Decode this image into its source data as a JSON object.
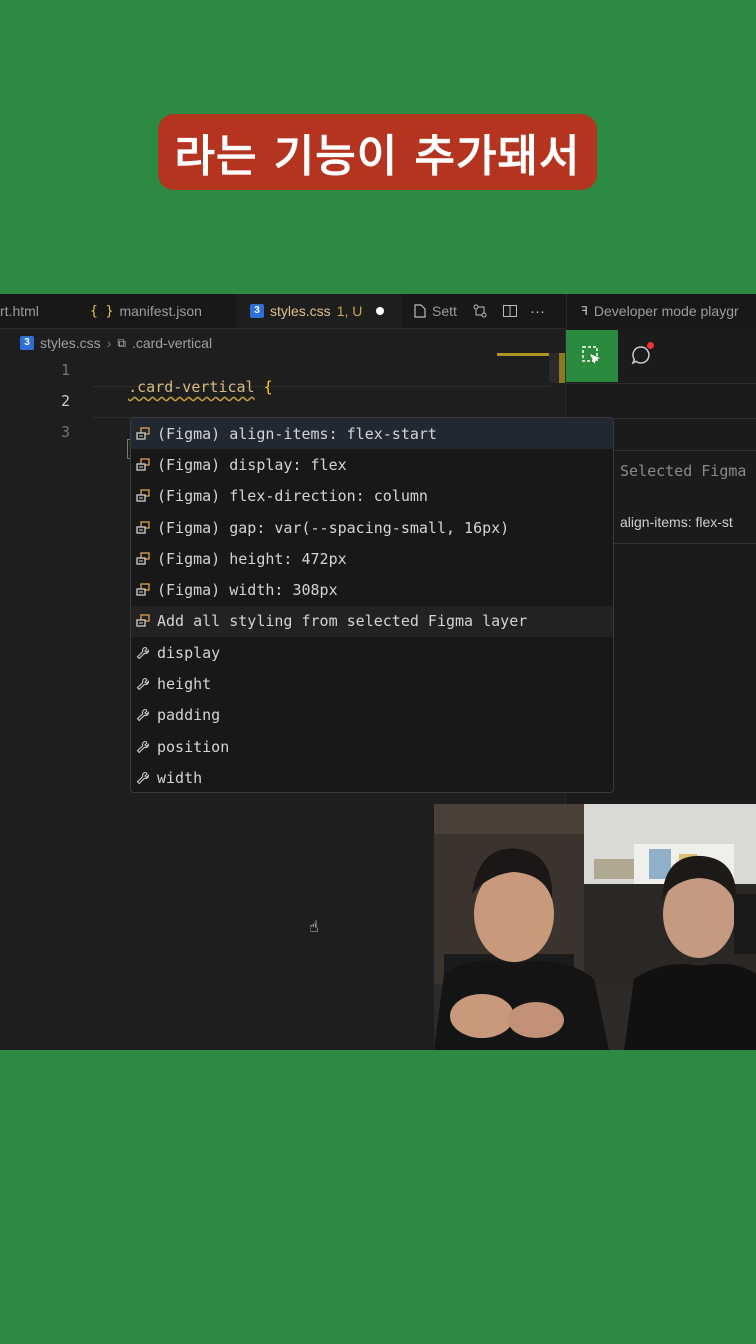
{
  "caption": "라는 기능이 추가돼서",
  "tabs": [
    {
      "label": "rt.html"
    },
    {
      "label": "manifest.json",
      "icon": "{ }"
    },
    {
      "label": "styles.css",
      "badge": "1, U",
      "icon": "3"
    },
    {
      "label": "Sett"
    },
    {
      "label": "Developer mode playgr"
    }
  ],
  "breadcrumb": {
    "file": "styles.css",
    "symbol": ".card-vertical",
    "file_icon": "3"
  },
  "editor": {
    "line_numbers": [
      "1",
      "2",
      "3"
    ],
    "line1_selector": ".card-vertical",
    "line1_brace": "{",
    "line3_brace": "}"
  },
  "suggestions": [
    {
      "text": "(Figma) align-items: flex-start",
      "icon": "figma-snippet-icon",
      "selected": true
    },
    {
      "text": "(Figma) display: flex",
      "icon": "figma-snippet-icon"
    },
    {
      "text": "(Figma) flex-direction: column",
      "icon": "figma-snippet-icon"
    },
    {
      "text": "(Figma) gap: var(--spacing-small, 16px)",
      "icon": "figma-snippet-icon"
    },
    {
      "text": "(Figma) height: 472px",
      "icon": "figma-snippet-icon"
    },
    {
      "text": "(Figma) width: 308px",
      "icon": "figma-snippet-icon"
    },
    {
      "text": "Add all styling from selected Figma layer",
      "icon": "figma-snippet-icon",
      "hover": true
    },
    {
      "text": "display",
      "icon": "wrench-icon"
    },
    {
      "text": "height",
      "icon": "wrench-icon"
    },
    {
      "text": "padding",
      "icon": "wrench-icon"
    },
    {
      "text": "position",
      "icon": "wrench-icon"
    },
    {
      "text": "width",
      "icon": "wrench-icon"
    }
  ],
  "right_panel": {
    "selected_label": "Selected Figma",
    "property": "align-items: flex-st"
  },
  "colors": {
    "background": "#2c8a43",
    "caption_bg": "#b5341f",
    "editor_bg": "#1e1e1e",
    "selector": "#d7ba7d",
    "brace": "#ffd700",
    "figma_green": "#2a8a3e"
  }
}
